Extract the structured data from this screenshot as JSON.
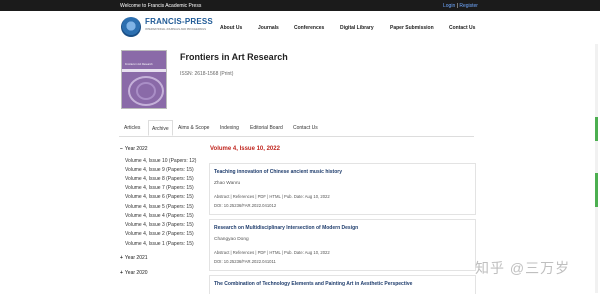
{
  "topbar": {
    "welcome": "Welcome to Francis Academic Press",
    "login": "Login",
    "separator": "|",
    "register": "Register"
  },
  "brand": {
    "name": "FRANCIS-PRESS",
    "tagline": "INTERNATIONAL JOURNALS AND PROCEEDINGS",
    "accent": "#1f5a96"
  },
  "nav": {
    "items": [
      "About Us",
      "Journals",
      "Conferences",
      "Digital Library",
      "Paper Submission",
      "Contact Us"
    ]
  },
  "journal": {
    "title": "Frontiers in Art Research",
    "issn": "ISSN: 2618-1568 (Print)",
    "cover_title": "Frontiers in Art Research"
  },
  "tabs": [
    "Articles",
    "Archive",
    "Aims & Scope",
    "Indexing",
    "Editorial Board",
    "Contact Us"
  ],
  "active_tab": "Archive",
  "archive": {
    "years": [
      {
        "toggle": "−",
        "label": "Year 2022"
      },
      {
        "toggle": "+",
        "label": "Year 2021"
      },
      {
        "toggle": "+",
        "label": "Year 2020"
      }
    ],
    "volumes_2022": [
      "Volume 4, Issue 10 (Papers: 12)",
      "Volume 4, Issue 9 (Papers: 15)",
      "Volume 4, Issue 8 (Papers: 15)",
      "Volume 4, Issue 7 (Papers: 15)",
      "Volume 4, Issue 6 (Papers: 15)",
      "Volume 4, Issue 5 (Papers: 15)",
      "Volume 4, Issue 4 (Papers: 15)",
      "Volume 4, Issue 3 (Papers: 15)",
      "Volume 4, Issue 2 (Papers: 15)",
      "Volume 4, Issue 1 (Papers: 15)"
    ]
  },
  "issue_heading": "Volume 4, Issue 10, 2022",
  "articles": [
    {
      "title": "Teaching innovation of Chinese ancient music history",
      "author": "Zhao Wanru",
      "links": "Abstract | References | PDF | HTML | Pub. Date: Aug 10, 2022",
      "doi": "DOI: 10.25236/FAR.2022.041012"
    },
    {
      "title": "Research on Multidisciplinary Intersection of Modern Design",
      "author": "Changyao Dong",
      "links": "Abstract | References | PDF | HTML | Pub. Date: Aug 10, 2022",
      "doi": "DOI: 10.25236/FAR.2022.041011"
    },
    {
      "title": "The Combination of Technology Elements and Painting Art in Aesthetic Perspective",
      "author": "",
      "links": "",
      "doi": ""
    }
  ],
  "watermark": "知乎 @三万岁",
  "colors": {
    "topbar_bg": "#1b1b1b",
    "issue_red": "#c0261f",
    "title_blue": "#1f3d6d"
  }
}
